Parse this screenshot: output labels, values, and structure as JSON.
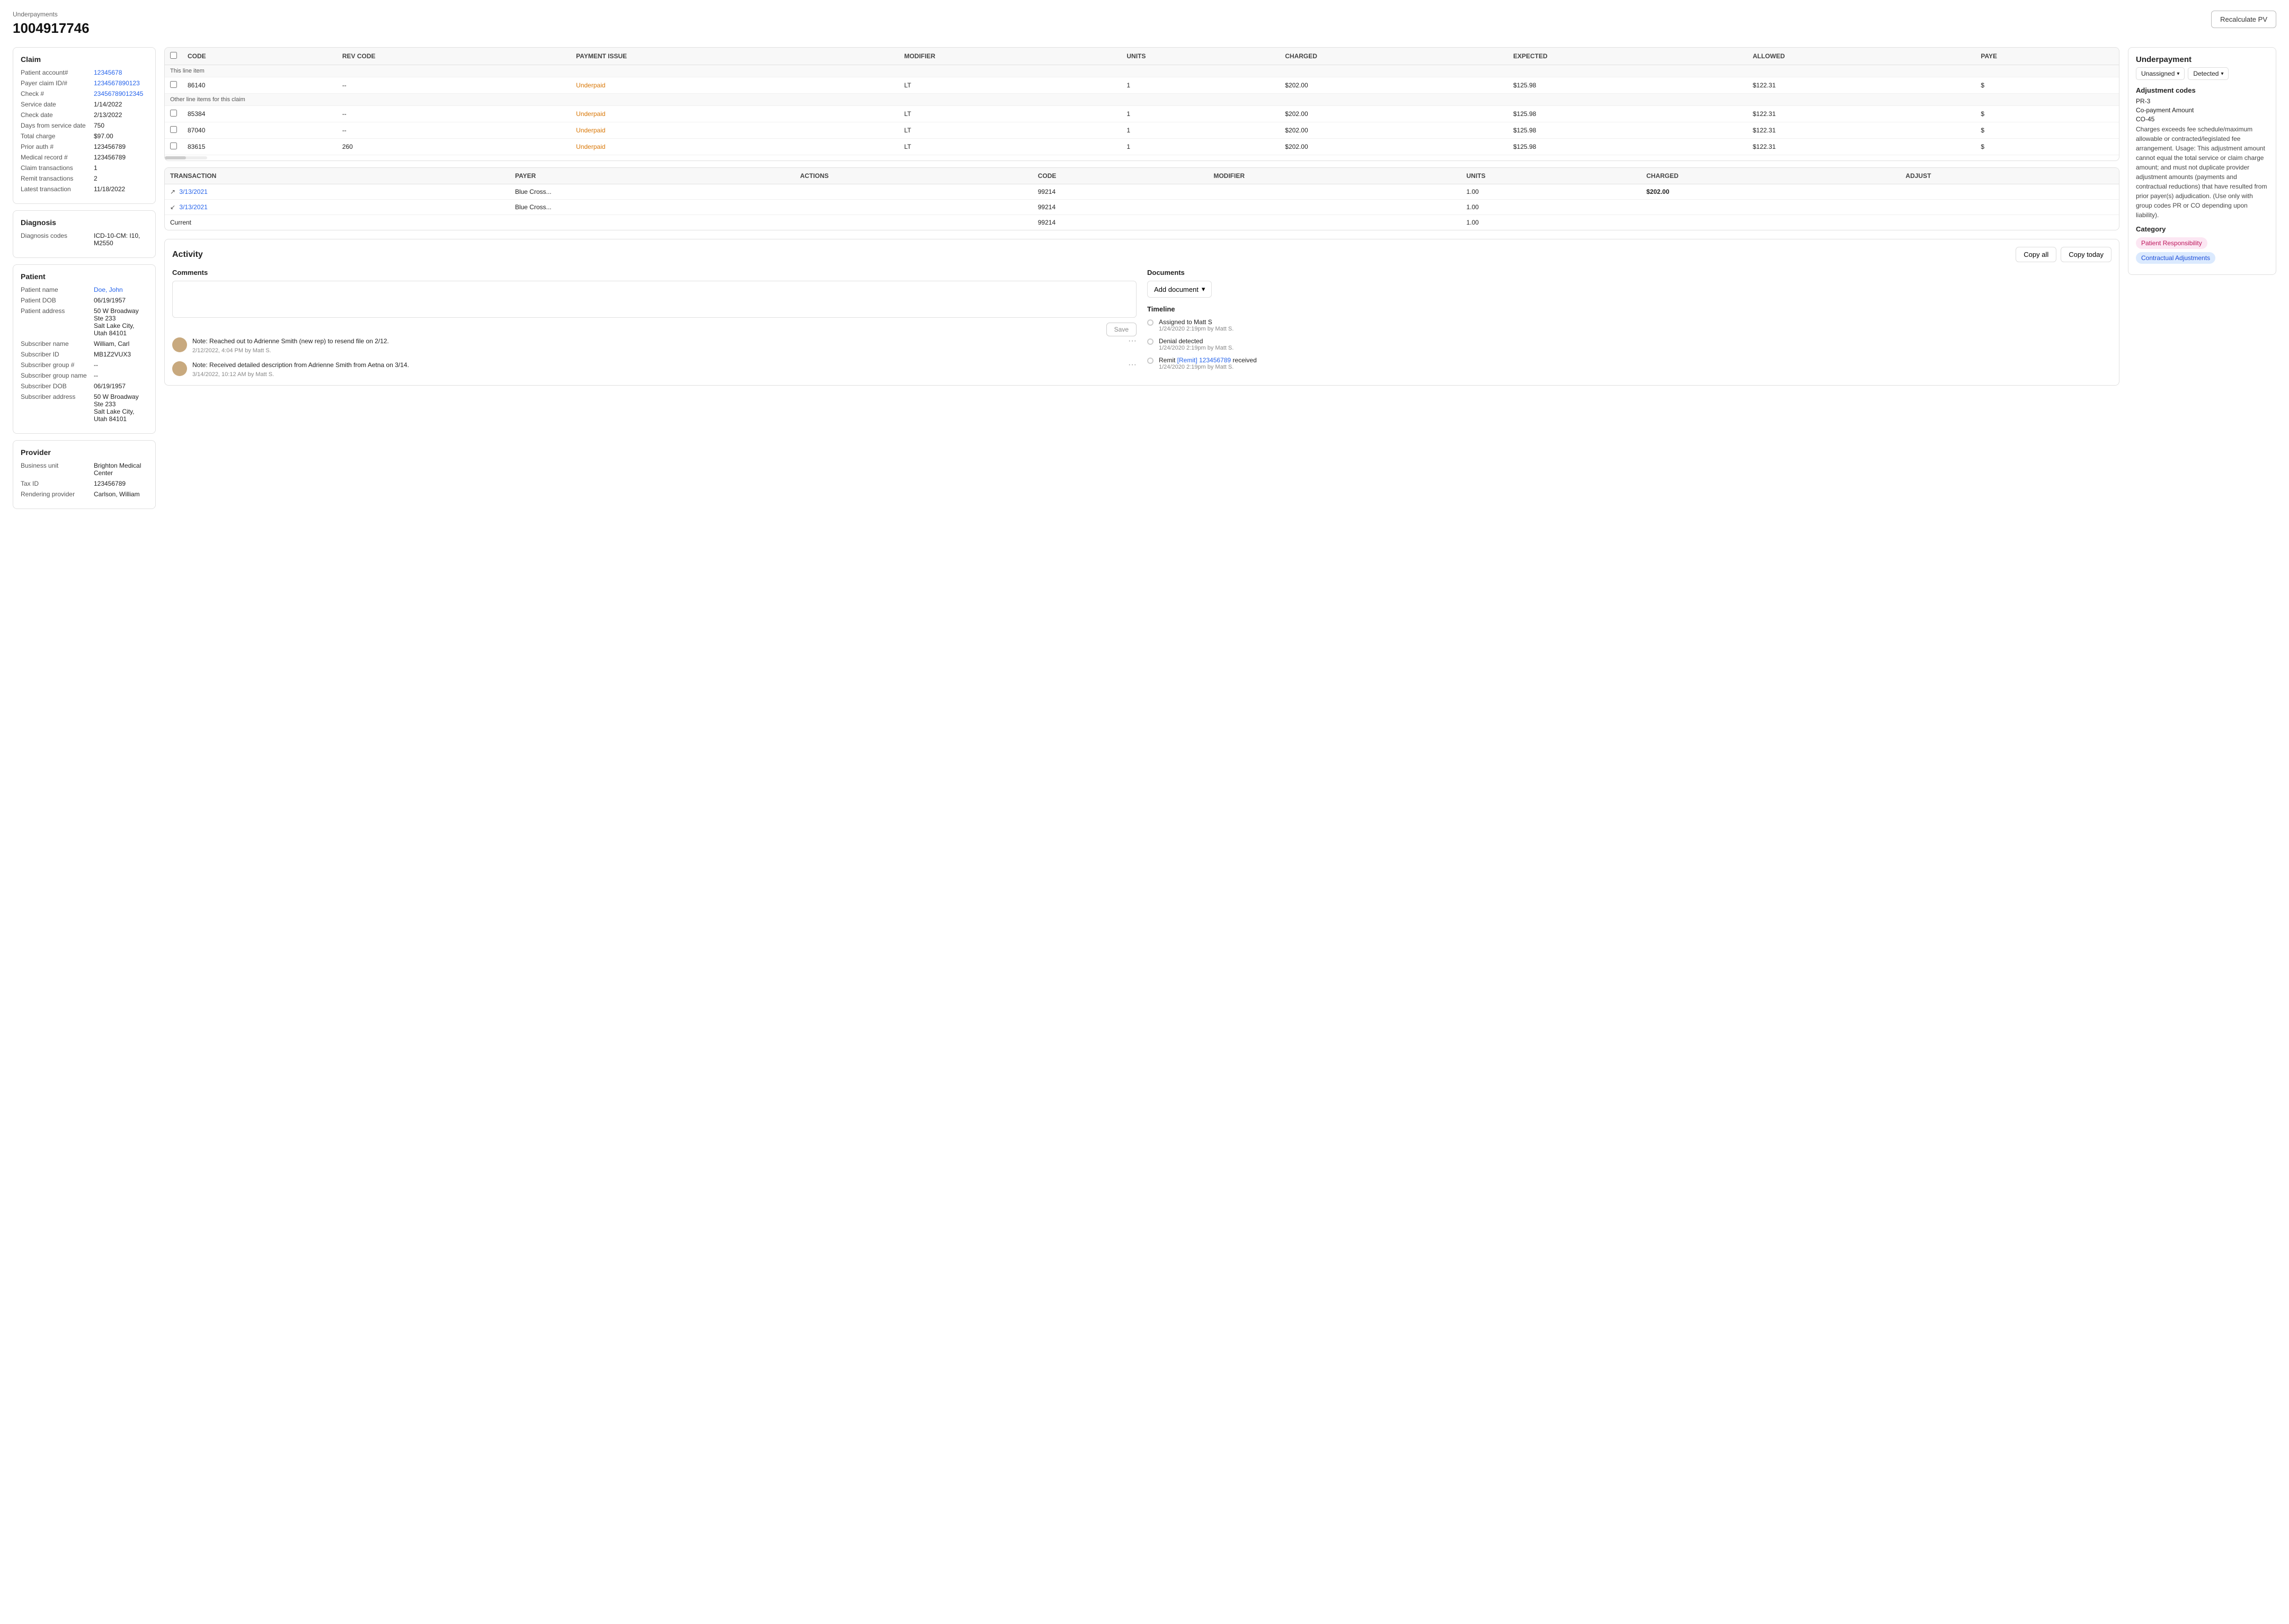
{
  "breadcrumb": "Underpayments",
  "pageTitle": "1004917746",
  "recalcBtn": "Recalculate PV",
  "claim": {
    "sectionTitle": "Claim",
    "rows": [
      {
        "label": "Patient account#",
        "value": "12345678",
        "type": "link"
      },
      {
        "label": "Payer claim ID/#",
        "value": "1234567890123",
        "type": "link"
      },
      {
        "label": "Check #",
        "value": "23456789012345",
        "type": "link"
      },
      {
        "label": "Service date",
        "value": "1/14/2022",
        "type": "text"
      },
      {
        "label": "Check date",
        "value": "2/13/2022",
        "type": "text"
      },
      {
        "label": "Days from service date",
        "value": "750",
        "type": "text"
      },
      {
        "label": "Total charge",
        "value": "$97.00",
        "type": "text"
      },
      {
        "label": "Prior auth #",
        "value": "123456789",
        "type": "text"
      },
      {
        "label": "Medical record #",
        "value": "123456789",
        "type": "text"
      },
      {
        "label": "Claim transactions",
        "value": "1",
        "type": "text"
      },
      {
        "label": "Remit transactions",
        "value": "2",
        "type": "text"
      },
      {
        "label": "Latest transaction",
        "value": "11/18/2022",
        "type": "text"
      }
    ]
  },
  "diagnosis": {
    "sectionTitle": "Diagnosis",
    "rows": [
      {
        "label": "Diagnosis codes",
        "value": "ICD-10-CM: I10, M2550",
        "type": "text"
      }
    ]
  },
  "patient": {
    "sectionTitle": "Patient",
    "rows": [
      {
        "label": "Patient name",
        "value": "Doe, John",
        "type": "link"
      },
      {
        "label": "Patient DOB",
        "value": "06/19/1957",
        "type": "text"
      },
      {
        "label": "Patient address",
        "value": "50 W Broadway Ste 233\nSalt Lake City, Utah 84101",
        "type": "text"
      },
      {
        "label": "Subscriber name",
        "value": "William, Carl",
        "type": "text"
      },
      {
        "label": "Subscriber ID",
        "value": "MB1Z2VUX3",
        "type": "text"
      },
      {
        "label": "Subscriber group #",
        "value": "--",
        "type": "text"
      },
      {
        "label": "Subscriber group name",
        "value": "--",
        "type": "text"
      },
      {
        "label": "Subscriber DOB",
        "value": "06/19/1957",
        "type": "text"
      },
      {
        "label": "Subscriber address",
        "value": "50 W Broadway Ste 233\nSalt Lake City, Utah 84101",
        "type": "text"
      }
    ]
  },
  "provider": {
    "sectionTitle": "Provider",
    "rows": [
      {
        "label": "Business unit",
        "value": "Brighton Medical Center",
        "type": "text"
      },
      {
        "label": "Tax ID",
        "value": "123456789",
        "type": "text"
      },
      {
        "label": "Rendering provider",
        "value": "Carlson, William",
        "type": "text"
      }
    ]
  },
  "claimsTable": {
    "headers": [
      "",
      "CODE",
      "REV CODE",
      "PAYMENT ISSUE",
      "MODIFIER",
      "UNITS",
      "CHARGED",
      "EXPECTED",
      "ALLOWED",
      "PAYE"
    ],
    "thisLineItem": "This line item",
    "lineItems": [
      {
        "code": "86140",
        "revCode": "--",
        "issue": "Underpaid",
        "modifier": "LT",
        "units": "1",
        "charged": "$202.00",
        "expected": "$125.98",
        "allowed": "$122.31",
        "paye": "$"
      }
    ],
    "otherLineItems": "Other line items for this claim",
    "otherItems": [
      {
        "code": "85384",
        "revCode": "--",
        "issue": "Underpaid",
        "modifier": "LT",
        "units": "1",
        "charged": "$202.00",
        "expected": "$125.98",
        "allowed": "$122.31",
        "paye": "$"
      },
      {
        "code": "87040",
        "revCode": "--",
        "issue": "Underpaid",
        "modifier": "LT",
        "units": "1",
        "charged": "$202.00",
        "expected": "$125.98",
        "allowed": "$122.31",
        "paye": "$"
      },
      {
        "code": "83615",
        "revCode": "260",
        "issue": "Underpaid",
        "modifier": "LT",
        "units": "1",
        "charged": "$202.00",
        "expected": "$125.98",
        "allowed": "$122.31",
        "paye": "$"
      }
    ]
  },
  "transactionsTable": {
    "headers": [
      "TRANSACTION",
      "PAYER",
      "ACTIONS",
      "CODE",
      "MODIFIER",
      "UNITS",
      "CHARGED",
      "ADJUST"
    ],
    "rows": [
      {
        "type": "up",
        "date": "3/13/2021",
        "payer": "Blue Cross...",
        "actions": "",
        "code": "99214",
        "modifier": "",
        "units": "1.00",
        "charged": "$202.00",
        "adjust": ""
      },
      {
        "type": "down",
        "date": "3/13/2021",
        "payer": "Blue Cross...",
        "actions": "",
        "code": "99214",
        "modifier": "",
        "units": "1.00",
        "charged": "",
        "adjust": ""
      }
    ],
    "currentRow": {
      "label": "Current",
      "code": "99214",
      "units": "1.00"
    }
  },
  "activity": {
    "title": "Activity",
    "copyAllBtn": "Copy all",
    "copyTodayBtn": "Copy today",
    "commentsLabel": "Comments",
    "saveBtn": "Save",
    "documentsLabel": "Documents",
    "addDocumentBtn": "Add document",
    "timelineTitle": "Timeline",
    "notes": [
      {
        "text": "Note: Reached out to Adrienne Smith (new rep) to resend file on 2/12.",
        "meta": "2/12/2022, 4:04 PM by Matt S."
      },
      {
        "text": "Note: Received detailed description from Adrienne Smith from Aetna on 3/14.",
        "meta": "3/14/2022, 10:12 AM by Matt S."
      }
    ],
    "timeline": [
      {
        "event": "Assigned to Matt S",
        "meta": "1/24/2020 2:19pm by Matt S."
      },
      {
        "event": "Denial detected",
        "meta": "1/24/2020 2:19pm by Matt S."
      },
      {
        "eventPre": "Remit ",
        "eventLink": "[Remit] 123456789",
        "eventPost": " received",
        "meta": "1/24/2020 2:19pm by Matt S."
      }
    ]
  },
  "underpayment": {
    "title": "Underpayment",
    "badge1": "Unassigned",
    "badge2": "Detected",
    "adjCodesTitle": "Adjustment codes",
    "codes": [
      "PR-3",
      "Co-payment Amount",
      "CO-45"
    ],
    "longDesc": "Charges exceeds fee schedule/maximum allowable or contracted/legislated fee arrangement. Usage: This adjustment amount cannot equal the total service or claim charge amount; and must not duplicate provider adjustment amounts (payments and contractual reductions) that have resulted from prior payer(s) adjudication. (Use only with group codes PR or CO depending upon liability).",
    "categoryTitle": "Category",
    "tags": [
      {
        "label": "Patient Responsibility",
        "style": "pink"
      },
      {
        "label": "Contractual Adjustments",
        "style": "blue"
      }
    ]
  }
}
